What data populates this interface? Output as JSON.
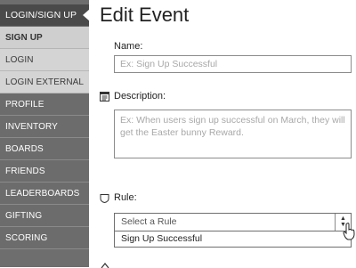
{
  "sidebar": {
    "header": "LOGIN/SIGN UP",
    "items": [
      {
        "label": "SIGN UP"
      },
      {
        "label": "LOGIN"
      },
      {
        "label": "LOGIN EXTERNAL"
      },
      {
        "label": "PROFILE"
      },
      {
        "label": "INVENTORY"
      },
      {
        "label": "BOARDS"
      },
      {
        "label": "FRIENDS"
      },
      {
        "label": "LEADERBOARDS"
      },
      {
        "label": "GIFTING"
      },
      {
        "label": "SCORING"
      }
    ]
  },
  "main": {
    "title": "Edit Event",
    "name": {
      "label": "Name:",
      "placeholder": "Ex: Sign Up Successful"
    },
    "description": {
      "label": "Description:",
      "placeholder": "Ex: When users sign up successful on March, they will get the Easter bunny Reward."
    },
    "rule": {
      "label": "Rule:",
      "placeholder": "Select a Rule",
      "options": [
        "Sign Up Successful"
      ]
    }
  }
}
